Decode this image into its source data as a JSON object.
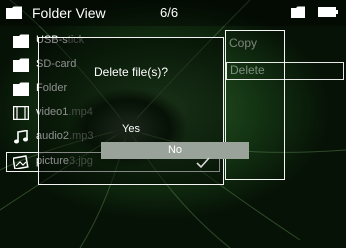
{
  "header": {
    "title": "Folder View",
    "counter": "6/6",
    "icons": [
      "folder-icon",
      "folder-icon",
      "battery-icon"
    ]
  },
  "files": [
    {
      "name": "USB-s",
      "ext": "tick",
      "icon": "folder-icon"
    },
    {
      "name": "SD-card",
      "ext": "",
      "icon": "folder-icon"
    },
    {
      "name": "Folder",
      "ext": "",
      "icon": "folder-icon"
    },
    {
      "name": "video1",
      "ext": ".mp4",
      "icon": "film-icon"
    },
    {
      "name": "audio2",
      "ext": ".mp3",
      "icon": "music-note-icon"
    },
    {
      "name": "picture",
      "ext": "3.jpg",
      "icon": "image-icon"
    }
  ],
  "context_menu": {
    "copy_label": "Copy",
    "delete_label": "Delete"
  },
  "dialog": {
    "question": "Delete file(s)?",
    "yes_label": "Yes",
    "no_label": "No"
  },
  "colors": {
    "accent_no": "#9aa39a",
    "border": "#f4f4f4",
    "text": "#ffffff"
  }
}
